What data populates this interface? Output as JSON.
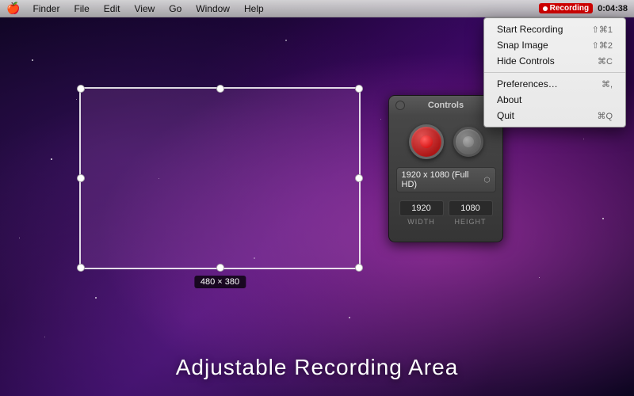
{
  "menubar": {
    "apple_symbol": "🍎",
    "items": [
      "Finder",
      "File",
      "Edit",
      "View",
      "Go",
      "Window",
      "Help"
    ],
    "clock": "0:04:38",
    "recording_label": "Recording"
  },
  "dropdown": {
    "items": [
      {
        "label": "Start Recording",
        "shortcut": "⇧⌘1"
      },
      {
        "label": "Snap Image",
        "shortcut": "⇧⌘2"
      },
      {
        "label": "Hide Controls",
        "shortcut": "⌘C"
      },
      {
        "separator": true
      },
      {
        "label": "Preferences…",
        "shortcut": "⌘,"
      },
      {
        "label": "About",
        "shortcut": ""
      },
      {
        "label": "Quit",
        "shortcut": "⌘Q"
      }
    ]
  },
  "selection": {
    "width_label": "480",
    "height_label": "380",
    "size_text": "480 × 380"
  },
  "controls": {
    "title": "Controls",
    "resolution": "1920 x 1080 (Full HD)",
    "width_value": "1920",
    "height_value": "1080",
    "width_label": "WIDTH",
    "height_label": "HEIGHT"
  },
  "bottom_title": "Adjustable Recording Area"
}
